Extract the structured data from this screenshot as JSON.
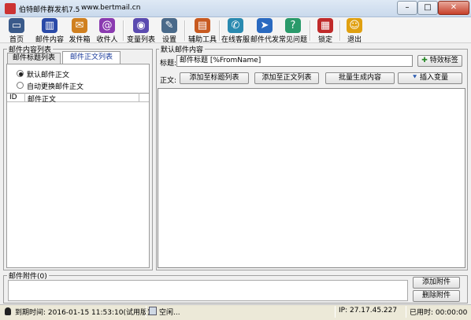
{
  "window": {
    "title": "伯特邮件群发机7.5",
    "url": "www.bertmail.cn",
    "minimize": "–",
    "maximize": "□",
    "close": "✕"
  },
  "toolbar": {
    "items": [
      {
        "label": "首页",
        "icon": "monitor-icon",
        "color": "#3a5a8a"
      },
      {
        "label": "邮件内容",
        "icon": "books-icon",
        "color": "#2a4aa8"
      },
      {
        "label": "发件箱",
        "icon": "outbox-icon",
        "color": "#d08020"
      },
      {
        "label": "收件人",
        "icon": "contacts-icon",
        "color": "#8a3ab0"
      },
      {
        "label": "变量列表",
        "icon": "globe-icon",
        "color": "#5a4ab0"
      },
      {
        "label": "设置",
        "icon": "wrench-icon",
        "color": "#4a6a8a"
      },
      {
        "label": "辅助工具",
        "icon": "film-icon",
        "color": "#c85a20"
      },
      {
        "label": "在线客服",
        "icon": "chat-icon",
        "color": "#2a8ab0"
      },
      {
        "label": "邮件代发",
        "icon": "send-icon",
        "color": "#2a6ac0"
      },
      {
        "label": "常见问题",
        "icon": "help-icon",
        "color": "#2a9a6a"
      },
      {
        "label": "锁定",
        "icon": "lock-icon",
        "color": "#c02a2a"
      },
      {
        "label": "退出",
        "icon": "exit-icon",
        "color": "#e0a010"
      }
    ]
  },
  "left_panel": {
    "title": "邮件内容列表",
    "tabs": [
      "邮件标题列表",
      "邮件正文列表"
    ],
    "active_tab": "邮件正文列表",
    "radio_default": "默认邮件正文",
    "radio_auto": "自动更换邮件正文",
    "columns": [
      "ID",
      "邮件正文"
    ]
  },
  "right_panel": {
    "title": "默认邮件内容",
    "subject_label": "标题:",
    "subject_value": "邮件标题  [%FromName]",
    "special_tag_button": "特效标签",
    "body_label": "正文:",
    "add_to_subjects": "添加至标题列表",
    "add_to_bodies": "添加至正文列表",
    "batch_generate": "批量生成内容",
    "insert_variable": "插入变量"
  },
  "attachments": {
    "title": "邮件附件(0)",
    "add_button": "添加附件",
    "delete_button": "删除附件"
  },
  "status": {
    "expire": "到期时间: 2016-01-15 11:53:10(试用版)",
    "state": "空闲...",
    "ip": "IP: 27.17.45.227",
    "elapsed": "已用时: 00:00:00"
  }
}
